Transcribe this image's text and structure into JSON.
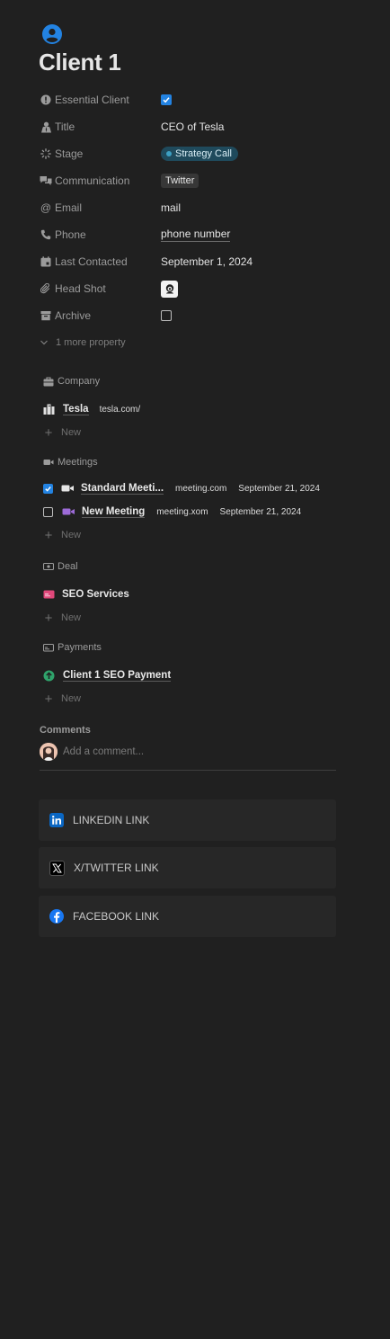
{
  "page": {
    "title": "Client 1",
    "icon": "user-circle-icon"
  },
  "properties": [
    {
      "key": "essential",
      "label": "Essential Client",
      "icon": "alert-circle-icon",
      "value": "",
      "checked": true
    },
    {
      "key": "title",
      "label": "Title",
      "icon": "person-icon",
      "value": "CEO of Tesla"
    },
    {
      "key": "stage",
      "label": "Stage",
      "icon": "loader-icon",
      "value": "Strategy Call"
    },
    {
      "key": "communication",
      "label": "Communication",
      "icon": "chat-bubbles-icon",
      "value": "Twitter"
    },
    {
      "key": "email",
      "label": "Email",
      "icon": "at-icon",
      "value": "mail"
    },
    {
      "key": "phone",
      "label": "Phone",
      "icon": "phone-icon",
      "value": "phone number"
    },
    {
      "key": "last_contacted",
      "label": "Last Contacted",
      "icon": "calendar-icon",
      "value": "September 1, 2024"
    },
    {
      "key": "head_shot",
      "label": "Head Shot",
      "icon": "paperclip-icon",
      "value": ""
    },
    {
      "key": "archive",
      "label": "Archive",
      "icon": "archive-box-icon",
      "value": "",
      "checked": false
    }
  ],
  "more_property": "1 more property",
  "company": {
    "label": "Company",
    "items": [
      {
        "name": "Tesla",
        "sub": "tesla.com/"
      }
    ],
    "new_label": "New"
  },
  "meetings": {
    "label": "Meetings",
    "items": [
      {
        "checked": true,
        "name": "Standard Meeti...",
        "url": "meeting.com",
        "date": "September 21, 2024"
      },
      {
        "checked": false,
        "name": "New Meeting",
        "url": "meeting.xom",
        "date": "September 21, 2024"
      }
    ],
    "new_label": "New"
  },
  "deal": {
    "label": "Deal",
    "items": [
      {
        "name": "SEO Services"
      }
    ],
    "new_label": "New"
  },
  "payments": {
    "label": "Payments",
    "items": [
      {
        "name": "Client 1 SEO Payment"
      }
    ],
    "new_label": "New"
  },
  "comments": {
    "title": "Comments",
    "placeholder": "Add a comment..."
  },
  "links": [
    {
      "label": "LINKEDIN LINK",
      "icon": "linkedin-icon",
      "color": "#0a66c2"
    },
    {
      "label": "X/TWITTER LINK",
      "icon": "x-twitter-icon",
      "color": "#000000"
    },
    {
      "label": "FACEBOOK LINK",
      "icon": "facebook-icon",
      "color": "#1877f2"
    }
  ]
}
